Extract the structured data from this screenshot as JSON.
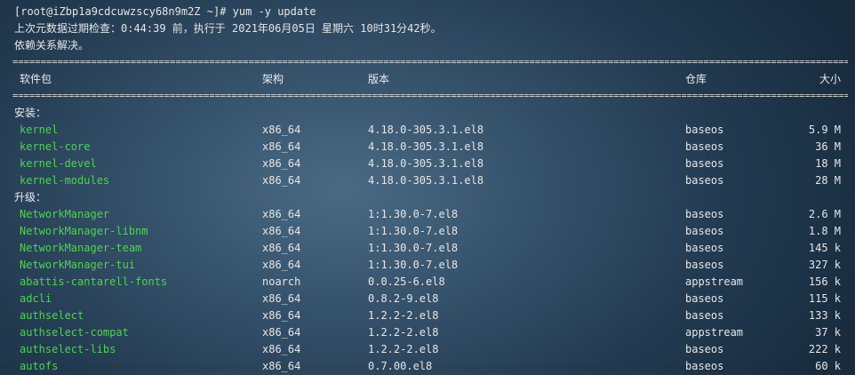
{
  "terminal": {
    "prompt": "[root@iZbp1a9cdcuwzscy68n9m2Z ~]# yum -y update",
    "info_line1": "上次元数据过期检查：0:44:39 前，执行于 2021年06月05日 星期六 10时31分42秒。",
    "info_line2": "依赖关系解决。",
    "separator": "================================================================================================================================================================================",
    "headers": {
      "package": "软件包",
      "arch": "架构",
      "version": "版本",
      "repo": "仓库",
      "size": "大小"
    },
    "sections": [
      {
        "title": "安装：",
        "packages": [
          {
            "name": "kernel",
            "arch": "x86_64",
            "version": "4.18.0-305.3.1.el8",
            "repo": "baseos",
            "size": "5.9 M"
          },
          {
            "name": "kernel-core",
            "arch": "x86_64",
            "version": "4.18.0-305.3.1.el8",
            "repo": "baseos",
            "size": "36 M"
          },
          {
            "name": "kernel-devel",
            "arch": "x86_64",
            "version": "4.18.0-305.3.1.el8",
            "repo": "baseos",
            "size": "18 M"
          },
          {
            "name": "kernel-modules",
            "arch": "x86_64",
            "version": "4.18.0-305.3.1.el8",
            "repo": "baseos",
            "size": "28 M"
          }
        ]
      },
      {
        "title": "升级：",
        "packages": [
          {
            "name": "NetworkManager",
            "arch": "x86_64",
            "version": "1:1.30.0-7.el8",
            "repo": "baseos",
            "size": "2.6 M"
          },
          {
            "name": "NetworkManager-libnm",
            "arch": "x86_64",
            "version": "1:1.30.0-7.el8",
            "repo": "baseos",
            "size": "1.8 M"
          },
          {
            "name": "NetworkManager-team",
            "arch": "x86_64",
            "version": "1:1.30.0-7.el8",
            "repo": "baseos",
            "size": "145 k"
          },
          {
            "name": "NetworkManager-tui",
            "arch": "x86_64",
            "version": "1:1.30.0-7.el8",
            "repo": "baseos",
            "size": "327 k"
          },
          {
            "name": "abattis-cantarell-fonts",
            "arch": "noarch",
            "version": "0.0.25-6.el8",
            "repo": "appstream",
            "size": "156 k"
          },
          {
            "name": "adcli",
            "arch": "x86_64",
            "version": "0.8.2-9.el8",
            "repo": "baseos",
            "size": "115 k"
          },
          {
            "name": "authselect",
            "arch": "x86_64",
            "version": "1.2.2-2.el8",
            "repo": "baseos",
            "size": "133 k"
          },
          {
            "name": "authselect-compat",
            "arch": "x86_64",
            "version": "1.2.2-2.el8",
            "repo": "appstream",
            "size": "37 k"
          },
          {
            "name": "authselect-libs",
            "arch": "x86_64",
            "version": "1.2.2-2.el8",
            "repo": "baseos",
            "size": "222 k"
          },
          {
            "name": "autofs",
            "arch": "x86_64",
            "version": "0.7.00.el8",
            "repo": "baseos",
            "size": "60 k"
          }
        ]
      }
    ]
  }
}
